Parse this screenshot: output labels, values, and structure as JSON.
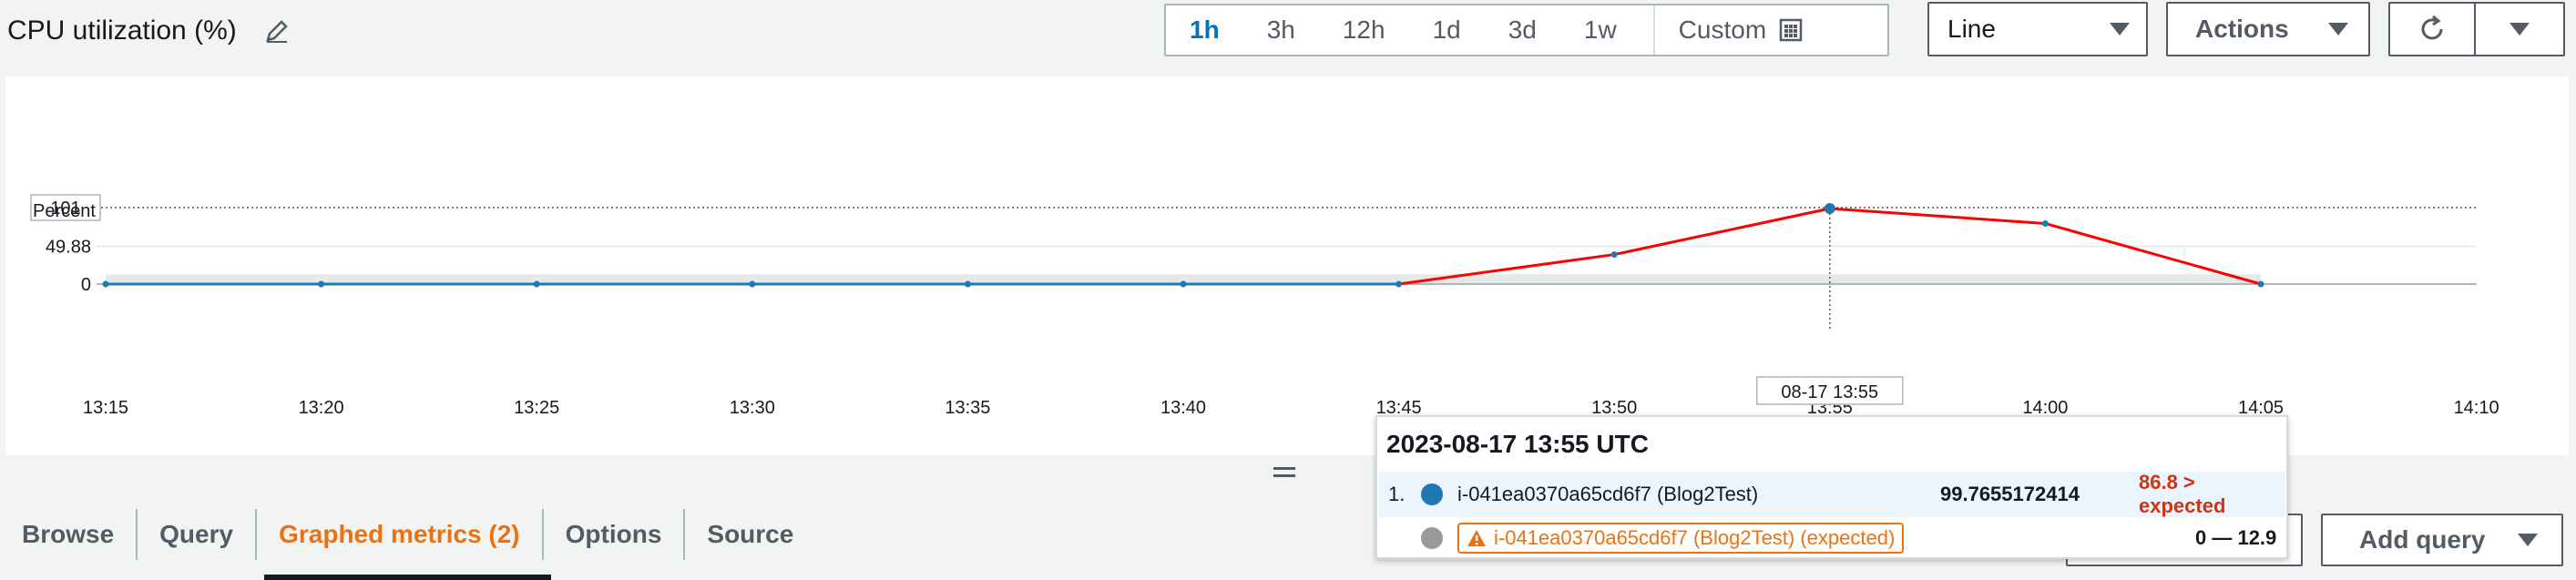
{
  "header": {
    "title": "CPU utilization (%)",
    "time_ranges": [
      "1h",
      "3h",
      "12h",
      "1d",
      "3d",
      "1w"
    ],
    "active_range": "1h",
    "custom_label": "Custom",
    "chart_type": "Line",
    "actions_label": "Actions"
  },
  "chart_data": {
    "type": "line",
    "ylabel": "Percent",
    "y_ticks": [
      "0",
      "49.88",
      "101"
    ],
    "ylim": [
      0,
      101
    ],
    "x_ticks": [
      "13:15",
      "13:20",
      "13:25",
      "13:30",
      "13:35",
      "13:40",
      "13:45",
      "13:50",
      "13:55",
      "14:00",
      "14:05",
      "14:10"
    ],
    "series": [
      {
        "x": [
          "13:15",
          "13:20",
          "13:25",
          "13:30",
          "13:35",
          "13:40",
          "13:45",
          "13:50",
          "13:55",
          "14:00",
          "14:05"
        ],
        "values": [
          0,
          0,
          0,
          0,
          0,
          0,
          0,
          39,
          99.77,
          80,
          0
        ],
        "color": "#1f77b4",
        "alarm_color": "#ff0000"
      }
    ],
    "expected_band": [
      0,
      12.9
    ],
    "hover_label": "08-17 13:55",
    "grid": true
  },
  "tooltip": {
    "title": "2023-08-17 13:55 UTC",
    "rows": [
      {
        "index": "1.",
        "name": "i-041ea0370a65cd6f7 (Blog2Test)",
        "value": "99.7655172414",
        "alert": "86.8 > expected",
        "dot_color": "#1f77b4"
      },
      {
        "name": "i-041ea0370a65cd6f7 (Blog2Test) (expected)",
        "value": "0 — 12.9",
        "dot_color": "#999999"
      }
    ]
  },
  "tabs": [
    {
      "label": "Browse"
    },
    {
      "label": "Query"
    },
    {
      "label": "Graphed metrics (2)"
    },
    {
      "label": "Options"
    },
    {
      "label": "Source"
    }
  ],
  "active_tab": "Graphed metrics (2)",
  "add_query_label": "Add query",
  "colors": {
    "accent": "#0073bb",
    "tab_active": "#ec7211",
    "alert": "#d13212"
  }
}
